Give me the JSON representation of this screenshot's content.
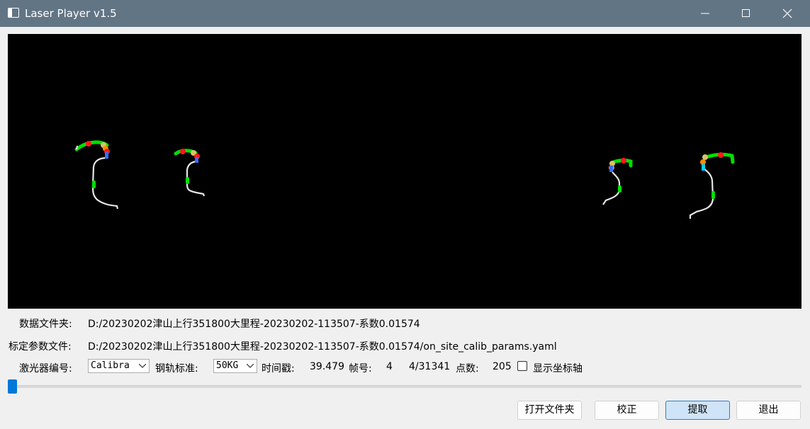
{
  "window": {
    "title": "Laser Player v1.5"
  },
  "fields": {
    "data_folder_label": "数据文件夹:",
    "data_folder_value": "D:/20230202津山上行351800大里程-20230202-113507-系数0.01574",
    "calib_file_label": "标定参数文件:",
    "calib_file_value": "D:/20230202津山上行351800大里程-20230202-113507-系数0.01574/on_site_calib_params.yaml"
  },
  "controls": {
    "laser_id_label": "激光器编号:",
    "laser_id_value": "Calibra",
    "rail_standard_label": "钢轨标准:",
    "rail_standard_value": "50KG",
    "timestamp_label": "时间戳:",
    "timestamp_value": "39.479",
    "frame_label": "帧号:",
    "frame_value": "4",
    "frame_progress": "4/31341",
    "points_label": "点数:",
    "points_value": "205",
    "show_axes_label": "显示坐标轴",
    "show_axes_checked": false
  },
  "slider": {
    "position_fraction": 0.0001
  },
  "buttons": {
    "open_folder": "打开文件夹",
    "calibrate": "校正",
    "extract": "提取",
    "exit": "退出"
  },
  "colors": {
    "titlebar": "#627585",
    "viewport_bg": "#000000",
    "profile_line": "#e6e6e6",
    "marker_green": "#00e000",
    "marker_red": "#ff1a1a",
    "marker_blue": "#3a6cff",
    "accent": "#0078d7"
  }
}
